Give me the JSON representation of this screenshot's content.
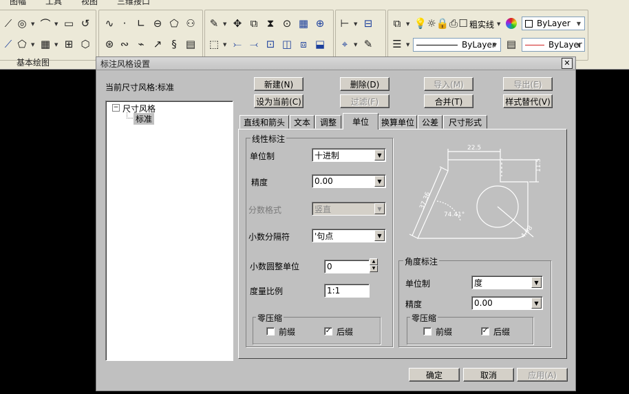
{
  "menubar": {
    "items": [
      "图幅",
      "工具",
      "视图",
      "三维接口"
    ]
  },
  "toolbar": {
    "group_label": "基本绘图",
    "lineweight_label": "粗实线",
    "color_value": "ByLayer",
    "linetype_value": "ByLayer",
    "linecolor_value": "ByLayer"
  },
  "dialog": {
    "title": "标注风格设置",
    "current_style_label": "当前尺寸风格:标准",
    "buttons": {
      "new": "新建(N)",
      "delete": "删除(D)",
      "import": "导入(M)",
      "export": "导出(E)",
      "set_current": "设为当前(C)",
      "filter": "过滤(F)",
      "merge": "合并(T)",
      "override": "样式替代(V)",
      "ok": "确定",
      "cancel": "取消",
      "apply": "应用(A)"
    },
    "tree": {
      "root": "尺寸风格",
      "child": "标准"
    },
    "tabs": [
      "直线和箭头",
      "文本",
      "调整",
      "单位",
      "换算单位",
      "公差",
      "尺寸形式"
    ],
    "active_tab": "单位",
    "linear": {
      "group_title": "线性标注",
      "unit_label": "单位制",
      "unit_value": "十进制",
      "precision_label": "精度",
      "precision_value": "0.00",
      "fraction_label": "分数格式",
      "fraction_value": "竖直",
      "decimal_sep_label": "小数分隔符",
      "decimal_sep_value": "'句点",
      "round_label": "小数圆整单位",
      "round_value": "0",
      "scale_label": "度量比例",
      "scale_value": "1:1",
      "zero_group": "零压缩",
      "leading_label": "前缀",
      "trailing_label": "后缀",
      "leading_checked": false,
      "trailing_checked": true
    },
    "angular": {
      "group_title": "角度标注",
      "unit_label": "单位制",
      "unit_value": "度",
      "precision_label": "精度",
      "precision_value": "0.00",
      "zero_group": "零压缩",
      "leading_label": "前缀",
      "trailing_label": "后缀",
      "leading_checked": false,
      "trailing_checked": true
    },
    "preview": {
      "dim_top": "22.5",
      "dim_right": "11.5",
      "dim_left": "37.36",
      "dim_angle": "74.41°",
      "dim_radius": "4.98"
    }
  }
}
